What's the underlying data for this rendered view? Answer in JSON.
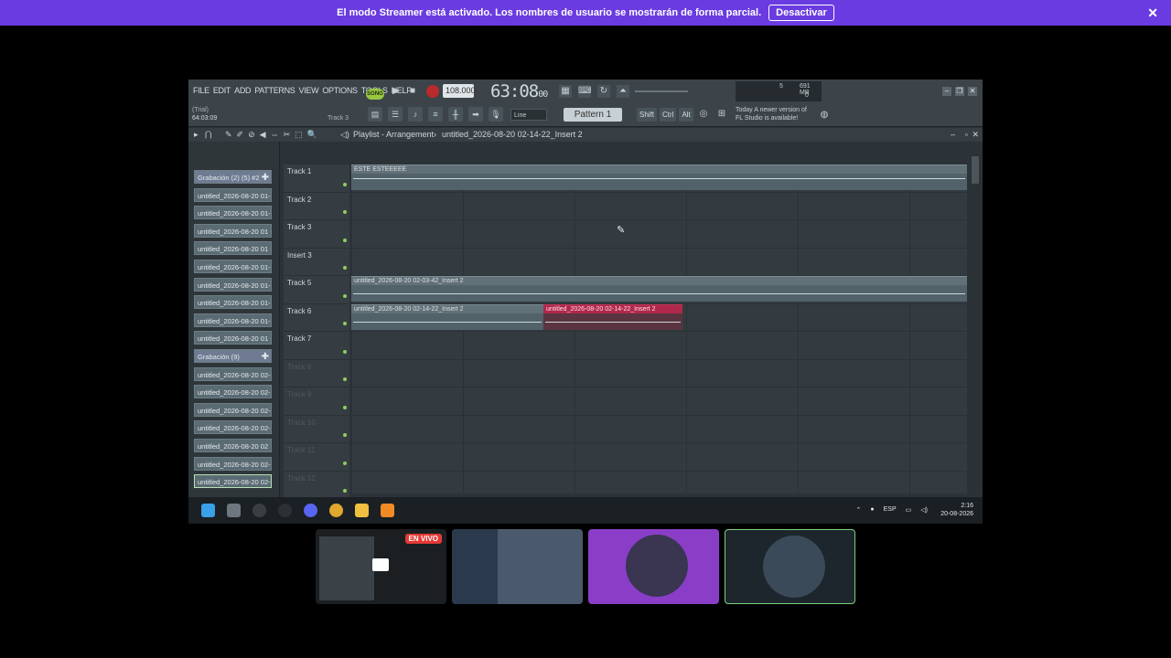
{
  "banner": {
    "message": "El modo Streamer está activado. Los nombres de usuario se mostrarán de forma parcial.",
    "button": "Desactivar",
    "close_glyph": "✕"
  },
  "fl": {
    "menu": [
      "FILE",
      "EDIT",
      "ADD",
      "PATTERNS",
      "VIEW",
      "OPTIONS",
      "TOOLS",
      "HELP"
    ],
    "song_label": "SONG",
    "tempo": "108.000",
    "time_main": "63:08",
    "time_sub": "00",
    "hint_line1": "(Trial)",
    "hint_line2": "64:03:09",
    "track_hint": "Track 3",
    "line_mode": "Line",
    "pattern": "Pattern 1",
    "modifiers": [
      "Shift",
      "Ctrl",
      "Alt"
    ],
    "news_line1": "Today  A newer version of",
    "news_line2": "FL Studio is available!",
    "cpu_num": "5",
    "mem": "691 MB",
    "mem2": "0"
  },
  "playlist": {
    "title": "Playlist - Arrangement",
    "breadcrumb_sep": "›",
    "file": "untitled_2026-08-20 02-14-22_Insert 2",
    "browser_items": [
      {
        "label": "Grabación (2) (5) #2",
        "group": true
      },
      {
        "label": "untitled_2026-08-20 01-..."
      },
      {
        "label": "untitled_2026-08-20 01-..."
      },
      {
        "label": "untitled_2026-08-20 01 -"
      },
      {
        "label": "untitled_2026-08-20 01 -"
      },
      {
        "label": "untitled_2026-08-20 01-..."
      },
      {
        "label": "untitled_2026-08-20 01-..."
      },
      {
        "label": "untitled_2026-08-20 01-..."
      },
      {
        "label": "untitled_2026-08-20 01-..."
      },
      {
        "label": "untitled_2026-08-20 01 -"
      },
      {
        "label": "Grabación (9)",
        "group": true
      },
      {
        "label": "untitled_2026-08-20 02-..."
      },
      {
        "label": "untitled_2026-08-20 02-..."
      },
      {
        "label": "untitled_2026-08-20 02-..."
      },
      {
        "label": "untitled_2026-08-20 02-..."
      },
      {
        "label": "untitled_2026-08-20 02"
      },
      {
        "label": "untitled_2026-08-20 02-"
      },
      {
        "label": "untitled_2026-08-20 02-..."
      }
    ],
    "tracks": [
      "Track 1",
      "Track 2",
      "Track 3",
      "Insert 3",
      "Track 5",
      "Track 6",
      "Track 7",
      "Track 8",
      "Track 9",
      "Track 10",
      "Track 11",
      "Track 12"
    ],
    "clips": [
      {
        "label": "ESTE ESTEEEEE"
      },
      {
        "label": "untitled_2026-08-20 02-03-42_Insert 2"
      },
      {
        "label": "untitled_2026-08-20 02-14-22_Insert 2"
      },
      {
        "label": "untitled_2026-08-20 02-14-22_Insert 2"
      }
    ]
  },
  "taskbar": {
    "lang": "ESP",
    "time": "2:16",
    "date": "20-08-2026"
  },
  "participants": {
    "live_label": "EN VIVO"
  },
  "colors": {
    "banner": "#6a3be0",
    "accent_green": "#8fcf5a",
    "clip_red": "#b0284c"
  }
}
